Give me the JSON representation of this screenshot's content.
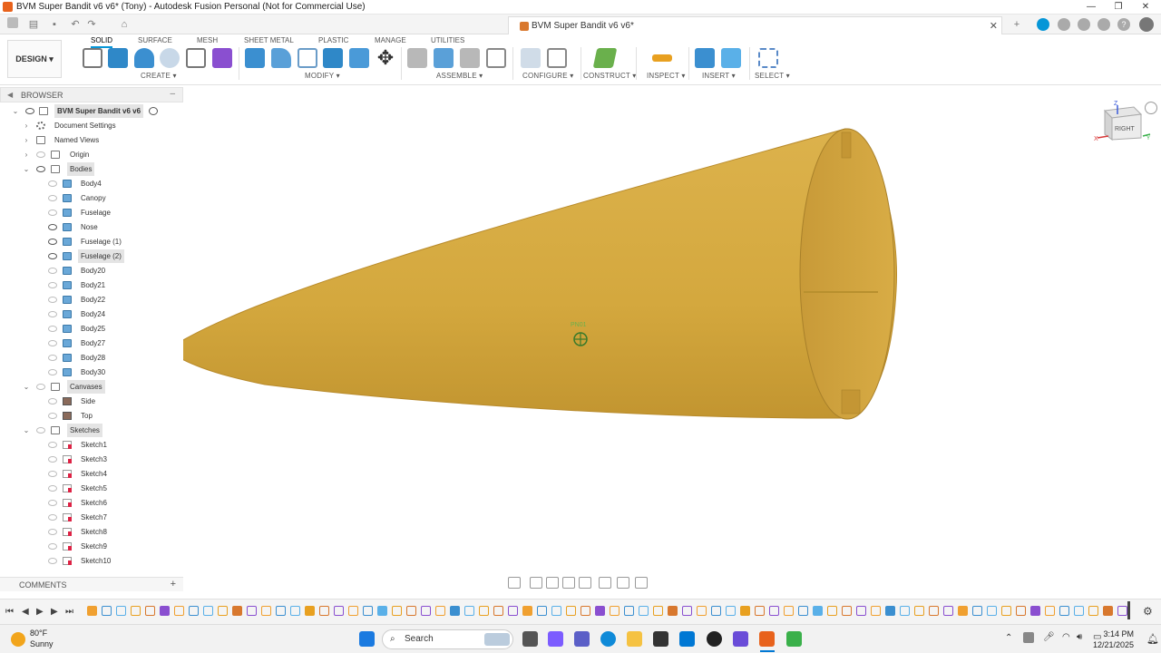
{
  "window": {
    "title": "BVM Super Bandit v6 v6* (Tony) - Autodesk Fusion Personal (Not for Commercial Use)",
    "controls": [
      "minimize-icon",
      "maximize-icon",
      "close-icon"
    ]
  },
  "doc_tab": {
    "label": "BVM Super Bandit v6 v6*"
  },
  "toolbar": {
    "workspace": "DESIGN",
    "tabs": [
      "SOLID",
      "SURFACE",
      "MESH",
      "SHEET METAL",
      "PLASTIC",
      "MANAGE",
      "UTILITIES"
    ],
    "active_tab": "SOLID",
    "groups": [
      "CREATE",
      "MODIFY",
      "ASSEMBLE",
      "CONFIGURE",
      "CONSTRUCT",
      "INSPECT",
      "INSERT",
      "SELECT"
    ]
  },
  "browser": {
    "title": "BROWSER",
    "root": "BVM Super Bandit v6 v6",
    "items": [
      "Document Settings",
      "Named Views",
      "Origin",
      "Bodies",
      "Body4",
      "Canopy",
      "Fuselage",
      "Nose",
      "Fuselage (1)",
      "Fuselage (2)",
      "Body20",
      "Body21",
      "Body22",
      "Body24",
      "Body25",
      "Body27",
      "Body28",
      "Body30",
      "Canvases",
      "Side",
      "Top",
      "Sketches",
      "Sketch1",
      "Sketch3",
      "Sketch4",
      "Sketch5",
      "Sketch6",
      "Sketch7",
      "Sketch8",
      "Sketch9",
      "Sketch10"
    ]
  },
  "comments": {
    "title": "COMMENTS"
  },
  "viewport": {
    "model_color": "#d8ac45",
    "pivot_label": "PN01",
    "viewcube_face": "RIGHT",
    "axes": {
      "z": "Z",
      "x": "X",
      "y": "Y"
    }
  },
  "taskbar": {
    "weather_temp": "80°F",
    "weather_desc": "Sunny",
    "search": "Search",
    "time": "3:14 PM",
    "date": "12/21/2025"
  }
}
